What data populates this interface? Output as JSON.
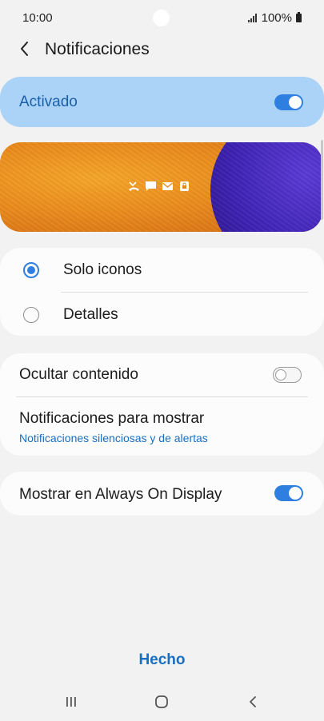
{
  "status_bar": {
    "time": "10:00",
    "battery": "100%"
  },
  "header": {
    "title": "Notificaciones",
    "back_icon": "chevron-left-icon"
  },
  "master_switch": {
    "label": "Activado",
    "state": "on"
  },
  "preview": {
    "icons": [
      "missed-call-icon",
      "message-icon",
      "email-icon",
      "lock-icon"
    ]
  },
  "style_options": {
    "items": [
      {
        "label": "Solo iconos",
        "selected": true
      },
      {
        "label": "Detalles",
        "selected": false
      }
    ]
  },
  "options": {
    "hide_content": {
      "label": "Ocultar contenido",
      "state": "off"
    },
    "notifications_to_show": {
      "label": "Notificaciones para mostrar",
      "value": "Notificaciones silenciosas y de alertas"
    }
  },
  "aod": {
    "label": "Mostrar en Always On Display",
    "state": "on"
  },
  "footer": {
    "done_label": "Hecho"
  },
  "colors": {
    "accent": "#2f7fe0",
    "link": "#1a6fc0",
    "master_bg": "#abd3f7"
  }
}
